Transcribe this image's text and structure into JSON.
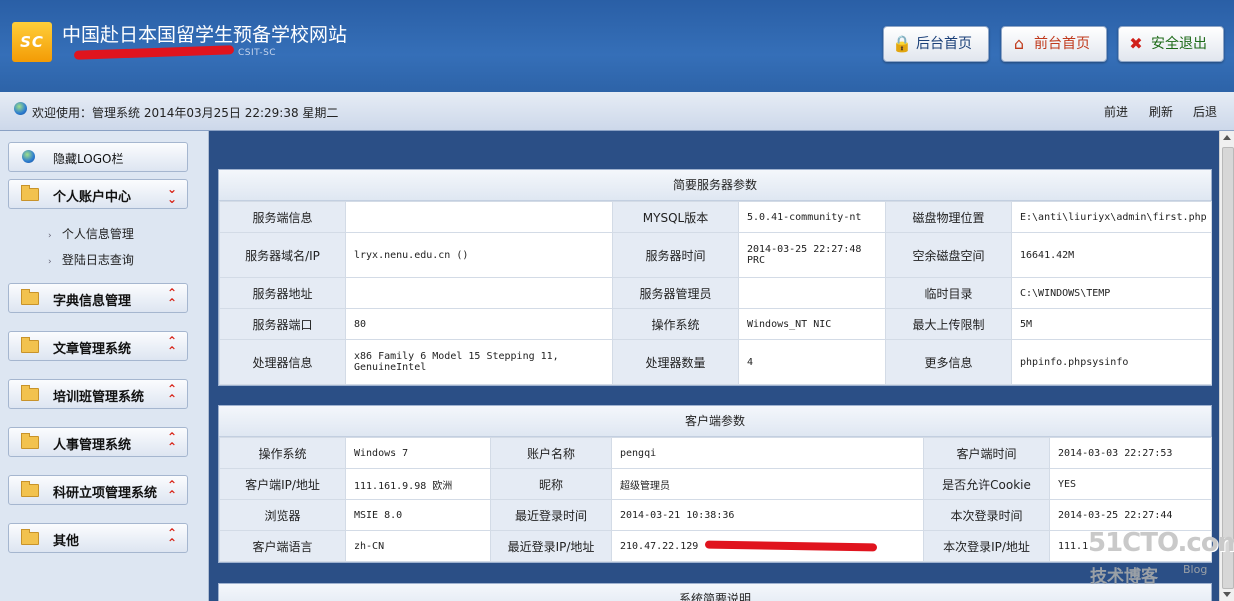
{
  "header": {
    "logo_text": "SC",
    "title": "中国赴日本国留学生预备学校网站",
    "subtitle": "CSIT-SC",
    "buttons": {
      "backend_home": "后台首页",
      "frontend_home": "前台首页",
      "logout": "安全退出"
    }
  },
  "bar": {
    "welcome": "欢迎使用：管理系统 2014年03月25日 22:29:38 星期二",
    "forward": "前进",
    "refresh": "刷新",
    "back": "后退"
  },
  "sidebar": {
    "hide_logo": "隐藏LOGO栏",
    "menus": [
      {
        "label": "个人账户中心",
        "chevron": "down"
      },
      {
        "label": "字典信息管理",
        "chevron": "up"
      },
      {
        "label": "文章管理系统",
        "chevron": "up"
      },
      {
        "label": "培训班管理系统",
        "chevron": "up"
      },
      {
        "label": "人事管理系统",
        "chevron": "up"
      },
      {
        "label": "科研立项管理系统",
        "chevron": "up"
      },
      {
        "label": "其他",
        "chevron": "up"
      }
    ],
    "submenu": [
      "个人信息管理",
      "登陆日志查询"
    ]
  },
  "server": {
    "title": "简要服务器参数",
    "rows": [
      [
        "服务端信息",
        "",
        "MYSQL版本",
        "5.0.41-community-nt",
        "磁盘物理位置",
        "E:\\anti\\liuriyx\\admin\\first.php"
      ],
      [
        "服务器域名/IP",
        "lryx.nenu.edu.cn ()",
        "服务器时间",
        "2014-03-25 22:27:48  PRC",
        "空余磁盘空间",
        "16641.42M"
      ],
      [
        "服务器地址",
        "",
        "服务器管理员",
        "",
        "临时目录",
        "C:\\WINDOWS\\TEMP"
      ],
      [
        "服务器端口",
        "80",
        "操作系统",
        "Windows_NT  NIC",
        "最大上传限制",
        "5M"
      ],
      [
        "处理器信息",
        "x86 Family 6 Model 15 Stepping 11, GenuineIntel",
        "处理器数量",
        "4",
        "更多信息",
        "phpinfo.phpsysinfo"
      ]
    ]
  },
  "client": {
    "title": "客户端参数",
    "rows": [
      [
        "操作系统",
        "Windows 7",
        "账户名称",
        "pengqi",
        "客户端时间",
        "2014-03-03 22:27:53"
      ],
      [
        "客户端IP/地址",
        "111.161.9.98 欧洲",
        "昵称",
        "超级管理员",
        "是否允许Cookie",
        "YES"
      ],
      [
        "浏览器",
        "MSIE 8.0",
        "最近登录时间",
        "2014-03-21 10:38:36",
        "本次登录时间",
        "2014-03-25 22:27:44"
      ],
      [
        "客户端语言",
        "zh-CN",
        "最近登录IP/地址",
        "210.47.22.129",
        "本次登录IP/地址",
        "111.1"
      ]
    ]
  },
  "system": {
    "title": "系统简要说明"
  },
  "watermark": {
    "site": "51CTO.com",
    "cn": "技术博客",
    "blog": "Blog"
  },
  "colors": {
    "header_blue": "#2d63a8",
    "main_bg": "#2b4f86",
    "chevron_red": "#d8261a",
    "redaction_red": "#e0141e"
  }
}
